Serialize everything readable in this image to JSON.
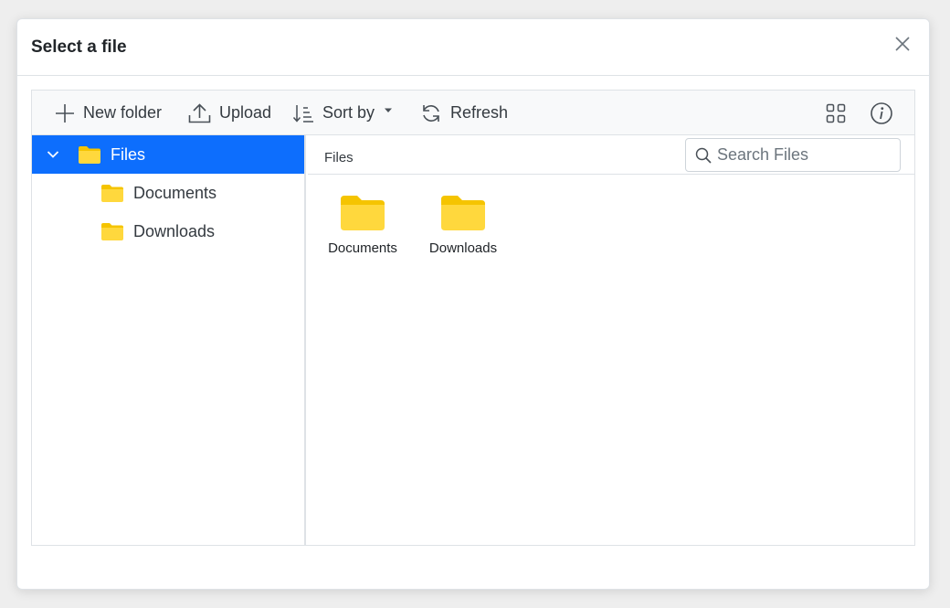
{
  "dialog": {
    "title": "Select a file"
  },
  "toolbar": {
    "new_folder": "New folder",
    "upload": "Upload",
    "sort_by": "Sort by",
    "refresh": "Refresh",
    "view_icon": "grid-view-icon",
    "details_icon": "info-icon"
  },
  "navigation": {
    "root": {
      "label": "Files",
      "expanded": true,
      "selected": true
    },
    "children": [
      {
        "label": "Documents"
      },
      {
        "label": "Downloads"
      }
    ]
  },
  "content": {
    "breadcrumb": "Files",
    "search": {
      "placeholder": "Search Files",
      "value": ""
    },
    "items": [
      {
        "label": "Documents",
        "icon": "folder-icon"
      },
      {
        "label": "Downloads",
        "icon": "folder-icon"
      }
    ]
  },
  "colors": {
    "accent": "#0d6efd",
    "folder": "#ffd83d",
    "folder_dark": "#f5c400"
  }
}
